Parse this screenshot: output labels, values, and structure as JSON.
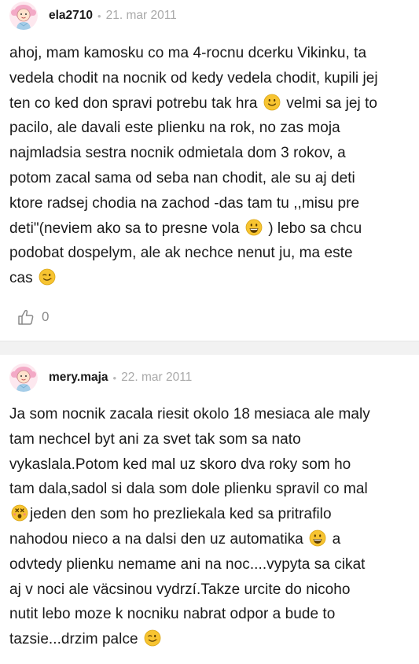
{
  "posts": [
    {
      "username": "ela2710",
      "separator": "•",
      "date": "21. mar 2011",
      "lines": [
        {
          "a": "ahoj, mam kamosku co ma 4-rocnu dcerku Vikinku, ta",
          "emoji": "",
          "b": ""
        },
        {
          "a": "vedela chodit na nocnik od kedy vedela chodit, kupili jej",
          "emoji": "",
          "b": ""
        },
        {
          "a": "ten co ked don spravi potrebu tak hra ",
          "emoji": "smile",
          "b": " velmi sa jej to"
        },
        {
          "a": "pacilo, ale davali este plienku na rok, no zas moja",
          "emoji": "",
          "b": ""
        },
        {
          "a": "najmladsia sestra nocnik odmietala dom 3 rokov, a",
          "emoji": "",
          "b": ""
        },
        {
          "a": "potom zacal sama od seba nan chodit, ale su aj deti",
          "emoji": "",
          "b": ""
        },
        {
          "a": "ktore radsej chodia na zachod -das tam tu ,,misu pre",
          "emoji": "",
          "b": ""
        },
        {
          "a": "deti\"(neviem ako sa to presne vola ",
          "emoji": "grin",
          "b": " ) lebo sa chcu"
        },
        {
          "a": "podobat dospelym, ale ak nechce nenut ju, ma este",
          "emoji": "",
          "b": ""
        },
        {
          "a": "cas ",
          "emoji": "wink",
          "b": ""
        }
      ],
      "likes": "0"
    },
    {
      "username": "mery.maja",
      "separator": "•",
      "date": "22. mar 2011",
      "lines": [
        {
          "a": "Ja som nocnik zacala riesit okolo 18 mesiaca ale maly",
          "emoji": "",
          "b": ""
        },
        {
          "a": "tam nechcel byt ani za svet tak som sa nato",
          "emoji": "",
          "b": ""
        },
        {
          "a": "vykaslala.Potom ked mal uz skoro dva roky som ho",
          "emoji": "",
          "b": ""
        },
        {
          "a": "tam dala,sadol si dala som dole plienku spravil co mal",
          "emoji": "",
          "b": ""
        },
        {
          "a": "",
          "emoji": "dizzy",
          "b": "jeden den som ho prezliekala ked sa pritrafilo"
        },
        {
          "a": "nahodou nieco a na dalsi den uz automatika ",
          "emoji": "grin",
          "b": " a"
        },
        {
          "a": "odvtedy plienku nemame ani na noc....vypyta sa cikat",
          "emoji": "",
          "b": ""
        },
        {
          "a": "aj v noci ale väcsinou vydrzí.Takze urcite do nicoho",
          "emoji": "",
          "b": ""
        },
        {
          "a": "nutit lebo moze k nocniku nabrat odpor a bude to",
          "emoji": "",
          "b": ""
        },
        {
          "a": "tazsie...drzim palce ",
          "emoji": "wink",
          "b": ""
        }
      ]
    }
  ],
  "icons": {
    "avatar": "girl-avatar-icon",
    "like": "thumbs-up-icon",
    "emoji_smile": "smile-emoji-icon",
    "emoji_grin": "grin-emoji-icon",
    "emoji_wink": "wink-emoji-icon",
    "emoji_dizzy": "dizzy-face-emoji-icon"
  },
  "colors": {
    "text": "#1a1a1a",
    "meta": "#a9a9a9",
    "separator_band": "#f2f2f2",
    "emoji_yellow": "#f7c431",
    "avatar_pink": "#f3a9c6"
  }
}
